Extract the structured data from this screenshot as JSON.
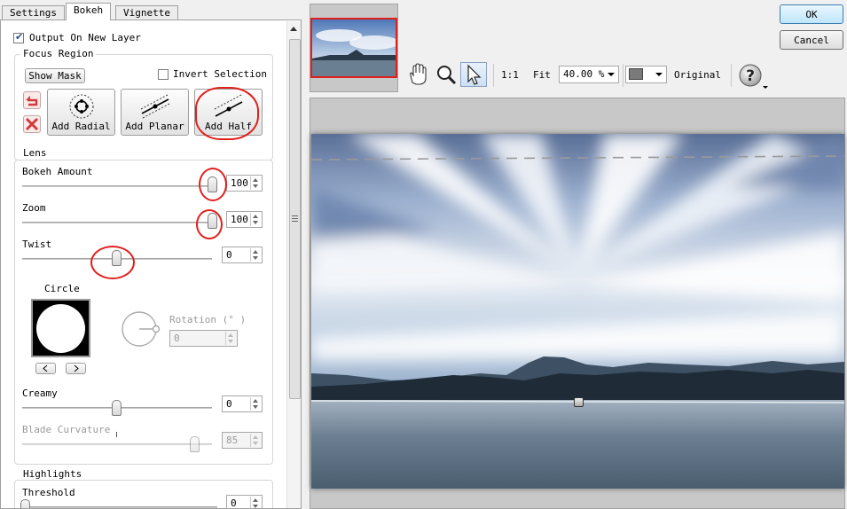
{
  "tabs": [
    {
      "label": "Settings",
      "active": false
    },
    {
      "label": "Bokeh",
      "active": true
    },
    {
      "label": "Vignette",
      "active": false
    }
  ],
  "output_layer": {
    "label": "Output On New Layer",
    "checked": true
  },
  "focus_region": {
    "title": "Focus Region",
    "show_mask_label": "Show Mask",
    "invert_selection": {
      "label": "Invert Selection",
      "checked": false
    },
    "add_radial_label": "Add Radial",
    "add_planar_label": "Add Planar",
    "add_half_label": "Add Half"
  },
  "lens": {
    "title": "Lens",
    "bokeh_amount": {
      "label": "Bokeh Amount",
      "value": "100",
      "level": 1.0
    },
    "zoom": {
      "label": "Zoom",
      "value": "100",
      "level": 1.0
    },
    "twist": {
      "label": "Twist",
      "value": "0",
      "level": 0.5
    },
    "shape": {
      "label": "Circle"
    },
    "rotation": {
      "label": "Rotation (° )",
      "value": "0"
    },
    "creamy": {
      "label": "Creamy",
      "value": "0",
      "level": 0.5
    },
    "blade_curvature": {
      "label": "Blade Curvature",
      "value": "85",
      "level": 0.92
    }
  },
  "highlights": {
    "title": "Highlights",
    "threshold": {
      "label": "Threshold",
      "value": "0",
      "level": 0.0
    }
  },
  "toolbar": {
    "one_to_one": "1:1",
    "fit": "Fit",
    "zoom_value": "40.00 %",
    "original": "Original",
    "background_color": "#7a7a7a"
  },
  "dialog": {
    "ok_label": "OK",
    "cancel_label": "Cancel"
  },
  "colors": {
    "annotation": "#e0201c",
    "thumbnail_border": "#e0201c"
  }
}
